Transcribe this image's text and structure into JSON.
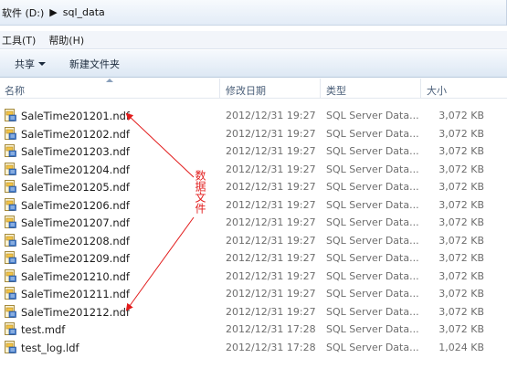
{
  "address": {
    "drive": "软件 (D:)",
    "folder": "sql_data"
  },
  "menu": {
    "tools": "工具(T)",
    "help": "帮助(H)"
  },
  "toolbar": {
    "share": "共享",
    "new_folder": "新建文件夹"
  },
  "columns": {
    "name": "名称",
    "date": "修改日期",
    "type": "类型",
    "size": "大小"
  },
  "files": [
    {
      "name": "SaleTime201201.ndf",
      "date": "2012/12/31 19:27",
      "type": "SQL Server Data...",
      "size": "3,072 KB"
    },
    {
      "name": "SaleTime201202.ndf",
      "date": "2012/12/31 19:27",
      "type": "SQL Server Data...",
      "size": "3,072 KB"
    },
    {
      "name": "SaleTime201203.ndf",
      "date": "2012/12/31 19:27",
      "type": "SQL Server Data...",
      "size": "3,072 KB"
    },
    {
      "name": "SaleTime201204.ndf",
      "date": "2012/12/31 19:27",
      "type": "SQL Server Data...",
      "size": "3,072 KB"
    },
    {
      "name": "SaleTime201205.ndf",
      "date": "2012/12/31 19:27",
      "type": "SQL Server Data...",
      "size": "3,072 KB"
    },
    {
      "name": "SaleTime201206.ndf",
      "date": "2012/12/31 19:27",
      "type": "SQL Server Data...",
      "size": "3,072 KB"
    },
    {
      "name": "SaleTime201207.ndf",
      "date": "2012/12/31 19:27",
      "type": "SQL Server Data...",
      "size": "3,072 KB"
    },
    {
      "name": "SaleTime201208.ndf",
      "date": "2012/12/31 19:27",
      "type": "SQL Server Data...",
      "size": "3,072 KB"
    },
    {
      "name": "SaleTime201209.ndf",
      "date": "2012/12/31 19:27",
      "type": "SQL Server Data...",
      "size": "3,072 KB"
    },
    {
      "name": "SaleTime201210.ndf",
      "date": "2012/12/31 19:27",
      "type": "SQL Server Data...",
      "size": "3,072 KB"
    },
    {
      "name": "SaleTime201211.ndf",
      "date": "2012/12/31 19:27",
      "type": "SQL Server Data...",
      "size": "3,072 KB"
    },
    {
      "name": "SaleTime201212.ndf",
      "date": "2012/12/31 19:27",
      "type": "SQL Server Data...",
      "size": "3,072 KB"
    },
    {
      "name": "test.mdf",
      "date": "2012/12/31 17:28",
      "type": "SQL Server Data...",
      "size": "3,072 KB"
    },
    {
      "name": "test_log.ldf",
      "date": "2012/12/31 17:28",
      "type": "SQL Server Data...",
      "size": "1,024 KB"
    }
  ],
  "annotation": {
    "text": "数据文件",
    "color": "#e21b1b"
  },
  "icons": {
    "file": "sql-data-file-icon",
    "share_dropdown": "chevron-down-icon",
    "breadcrumb": "breadcrumb-arrow-icon"
  }
}
